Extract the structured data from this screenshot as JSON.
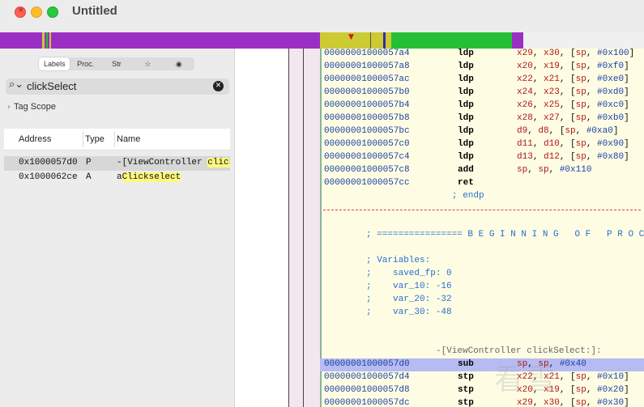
{
  "window": {
    "title": "Untitled"
  },
  "colors": {
    "nav_purple": "#9b2fc4",
    "nav_yellow": "#cccb33",
    "nav_green": "#25bf35",
    "nav_blue": "#3b2aa8",
    "code_bg": "#fefde4",
    "address_blue": "#1a3fa0",
    "register_red": "#b01515",
    "comment_blue": "#2a6dd0",
    "selection": "#b6bbf2"
  },
  "left_panel": {
    "tabs": [
      {
        "label": "Labels",
        "active": true
      },
      {
        "label": "Proc."
      },
      {
        "label": "Str"
      },
      {
        "label": "☆"
      },
      {
        "label": "◉"
      }
    ],
    "search": {
      "icon": "search-icon",
      "value": "clickSelect",
      "clear_icon": "clear-icon"
    },
    "tag_scope": "Tag Scope",
    "table": {
      "headers": [
        "Address",
        "Type",
        "Name"
      ],
      "rows": [
        {
          "address": "0x1000057d0",
          "type": "P",
          "name_prefix": "-[ViewController ",
          "name_match": "clickSe",
          "selected": true
        },
        {
          "address": "0x1000062ce",
          "type": "A",
          "name_prefix": "a",
          "name_match": "Clickselect",
          "selected": false
        }
      ]
    }
  },
  "code": {
    "epilogue": [
      {
        "addr": "00000001000057a4",
        "mn": "ldp",
        "r1": "x29",
        "r2": "x30",
        "base": "sp",
        "off": "#0x100"
      },
      {
        "addr": "00000001000057a8",
        "mn": "ldp",
        "r1": "x20",
        "r2": "x19",
        "base": "sp",
        "off": "#0xf0"
      },
      {
        "addr": "00000001000057ac",
        "mn": "ldp",
        "r1": "x22",
        "r2": "x21",
        "base": "sp",
        "off": "#0xe0"
      },
      {
        "addr": "00000001000057b0",
        "mn": "ldp",
        "r1": "x24",
        "r2": "x23",
        "base": "sp",
        "off": "#0xd0"
      },
      {
        "addr": "00000001000057b4",
        "mn": "ldp",
        "r1": "x26",
        "r2": "x25",
        "base": "sp",
        "off": "#0xc0"
      },
      {
        "addr": "00000001000057b8",
        "mn": "ldp",
        "r1": "x28",
        "r2": "x27",
        "base": "sp",
        "off": "#0xb0"
      },
      {
        "addr": "00000001000057bc",
        "mn": "ldp",
        "r1": "d9",
        "r2": "d8",
        "base": "sp",
        "off": "#0xa0"
      },
      {
        "addr": "00000001000057c0",
        "mn": "ldp",
        "r1": "d11",
        "r2": "d10",
        "base": "sp",
        "off": "#0x90"
      },
      {
        "addr": "00000001000057c4",
        "mn": "ldp",
        "r1": "d13",
        "r2": "d12",
        "base": "sp",
        "off": "#0x80"
      }
    ],
    "add_line": {
      "addr": "00000001000057c8",
      "mn": "add",
      "r1": "sp",
      "r2": "sp",
      "imm": "#0x110"
    },
    "ret_line": {
      "addr": "00000001000057cc",
      "mn": "ret"
    },
    "endp": "; endp",
    "proc_banner": "; ================ B E G I N N I N G   O F   P R O C",
    "variables_header": "; Variables:",
    "variables": [
      ";    saved_fp: 0",
      ";    var_10: -16",
      ";    var_20: -32",
      ";    var_30: -48"
    ],
    "proc_label": "-[ViewController clickSelect:]:",
    "prologue": [
      {
        "addr": "00000001000057d0",
        "mn": "sub",
        "r1": "sp",
        "r2": "sp",
        "imm": "#0x40",
        "selected": true
      },
      {
        "addr": "00000001000057d4",
        "mn": "stp",
        "r1": "x22",
        "r2": "x21",
        "base": "sp",
        "off": "#0x10"
      },
      {
        "addr": "00000001000057d8",
        "mn": "stp",
        "r1": "x20",
        "r2": "x19",
        "base": "sp",
        "off": "#0x20"
      },
      {
        "addr": "00000001000057dc",
        "mn": "stp",
        "r1": "x29",
        "r2": "x30",
        "base": "sp",
        "off": "#0x30"
      }
    ]
  },
  "watermark": "看雪"
}
